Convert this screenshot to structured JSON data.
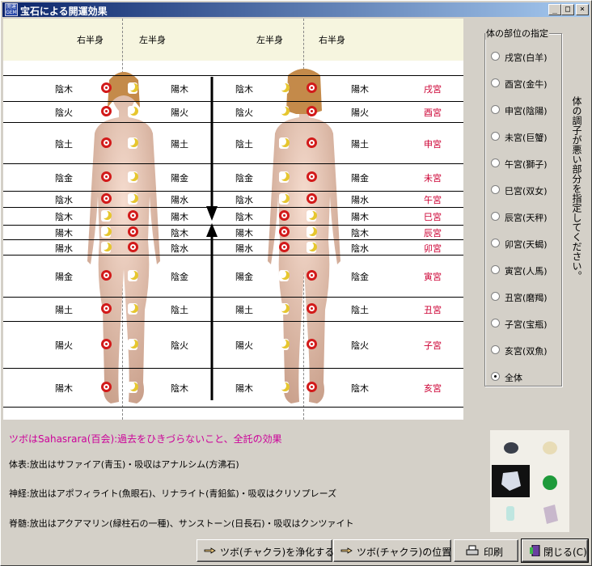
{
  "window": {
    "title": "宝石による開運効果",
    "icon_text": "開運\nGEM",
    "min_label": "_",
    "max_label": "□",
    "close_label": "×"
  },
  "chart": {
    "headers": {
      "right_half_front": "右半身",
      "left_half_front": "左半身",
      "left_half_back": "左半身",
      "right_half_back": "右半身"
    },
    "rows": [
      {
        "f_left": "陰木",
        "f_right": "陽木",
        "b_left": "陰木",
        "b_right": "陽木",
        "palace": "戌宮"
      },
      {
        "f_left": "陰火",
        "f_right": "陽火",
        "b_left": "陰火",
        "b_right": "陽火",
        "palace": "酉宮"
      },
      {
        "f_left": "陰土",
        "f_right": "陽土",
        "b_left": "陰土",
        "b_right": "陽土",
        "palace": "申宮"
      },
      {
        "f_left": "陰金",
        "f_right": "陽金",
        "b_left": "陰金",
        "b_right": "陽金",
        "palace": "未宮"
      },
      {
        "f_left": "陰水",
        "f_right": "陽水",
        "b_left": "陰水",
        "b_right": "陽水",
        "palace": "午宮"
      },
      {
        "f_left": "陰木",
        "f_right": "陽木",
        "b_left": "陰木",
        "b_right": "陽木",
        "palace": "巳宮"
      },
      {
        "f_left": "陽木",
        "f_right": "陰木",
        "b_left": "陽木",
        "b_right": "陰木",
        "palace": "辰宮"
      },
      {
        "f_left": "陽水",
        "f_right": "陰水",
        "b_left": "陽水",
        "b_right": "陰水",
        "palace": "卯宮"
      },
      {
        "f_left": "陽金",
        "f_right": "陰金",
        "b_left": "陽金",
        "b_right": "陰金",
        "palace": "寅宮"
      },
      {
        "f_left": "陽土",
        "f_right": "陰土",
        "b_left": "陽土",
        "b_right": "陰土",
        "palace": "丑宮"
      },
      {
        "f_left": "陽火",
        "f_right": "陰火",
        "b_left": "陽火",
        "b_right": "陰火",
        "palace": "子宮"
      },
      {
        "f_left": "陽木",
        "f_right": "陰木",
        "b_left": "陽木",
        "b_right": "陰木",
        "palace": "亥宮"
      }
    ],
    "colors": {
      "palace": "#cc0033",
      "dot": "#d21a1a",
      "moon": "#e6c62e",
      "header_bg": "#f6f5df"
    }
  },
  "body_part_group": {
    "title": "体の部位の指定",
    "options": [
      "戌宮(白羊)",
      "酉宮(金牛)",
      "申宮(陰陽)",
      "未宮(巨蟹)",
      "午宮(獅子)",
      "巳宮(双女)",
      "辰宮(天秤)",
      "卯宮(天蝎)",
      "寅宮(人馬)",
      "丑宮(磨羯)",
      "子宮(宝瓶)",
      "亥宮(双魚)",
      "全体"
    ],
    "selected": "全体"
  },
  "instruction": "体の調子が悪い部分を指定してください。",
  "tsubo_line": "ツボはSahasrara(百会):過去をひきづらないこと、全託の効果",
  "info": {
    "surface": "体表:放出はサファイア(青玉)・吸収はアナルシム(方沸石)",
    "nerve": "神経:放出はアポフィライト(魚眼石)、リナライト(青鉛鉱)・吸収はクリソプレーズ",
    "spine": "脊髄:放出はアクアマリン(緑柱石の一種)、サンストーン(日長石)・吸収はクンツァイト"
  },
  "buttons": {
    "purify": "ツボ(チャクラ)を浄化する",
    "position": "ツボ(チャクラ)の位置",
    "print": "印刷",
    "close": "閉じる(C)"
  }
}
